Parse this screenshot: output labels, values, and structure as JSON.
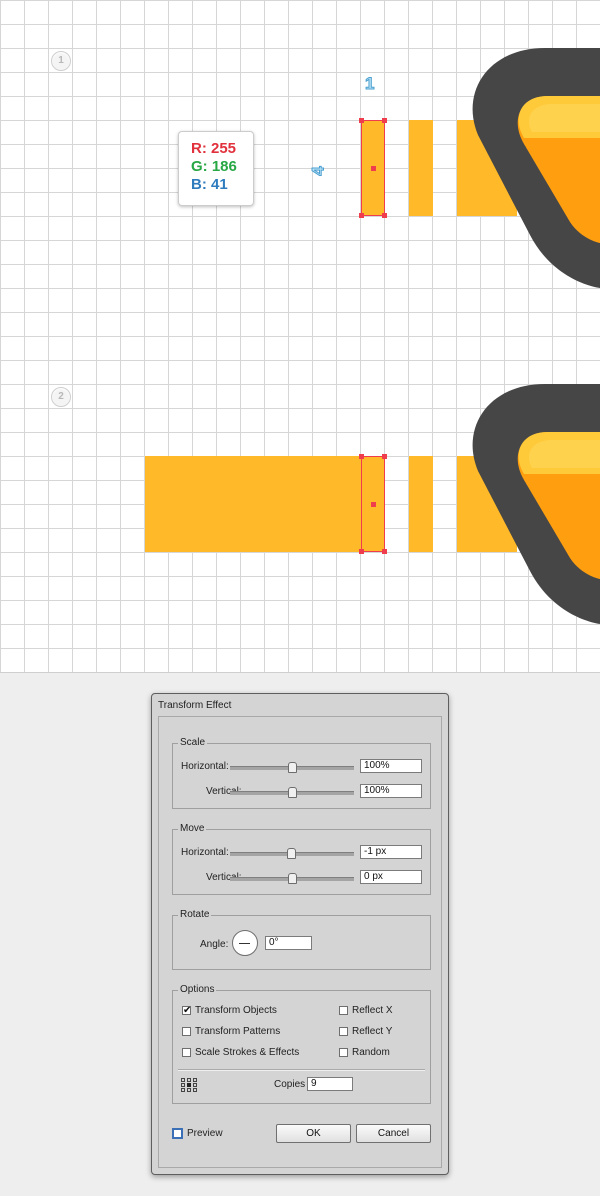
{
  "steps": [
    "1",
    "2"
  ],
  "dimensions": {
    "width": "1",
    "height": "4"
  },
  "fill_color": {
    "r_label": "R: 255",
    "g_label": "G: 186",
    "b_label": "B: 41",
    "r_color": "#e1313d",
    "g_color": "#28a745",
    "b_color": "#2e7bbd",
    "hex": "#ffb929"
  },
  "dialog": {
    "title": "Transform Effect",
    "scale": {
      "legend": "Scale",
      "horizontal_label": "Horizontal:",
      "horizontal_value": "100%",
      "vertical_label": "Vertical:",
      "vertical_value": "100%"
    },
    "move": {
      "legend": "Move",
      "horizontal_label": "Horizontal:",
      "horizontal_value": "-1 px",
      "vertical_label": "Vertical:",
      "vertical_value": "0 px"
    },
    "rotate": {
      "legend": "Rotate",
      "angle_label": "Angle:",
      "angle_value": "0°"
    },
    "options": {
      "legend": "Options",
      "transform_objects": "Transform Objects",
      "transform_objects_checked": true,
      "transform_patterns": "Transform Patterns",
      "transform_patterns_checked": false,
      "scale_strokes": "Scale Strokes & Effects",
      "scale_strokes_checked": false,
      "reflect_x": "Reflect X",
      "reflect_x_checked": false,
      "reflect_y": "Reflect Y",
      "reflect_y_checked": false,
      "random": "Random",
      "random_checked": false,
      "copies_label": "Copies",
      "copies_value": "9"
    },
    "preview_label": "Preview",
    "preview_checked": false,
    "ok_label": "OK",
    "cancel_label": "Cancel"
  }
}
